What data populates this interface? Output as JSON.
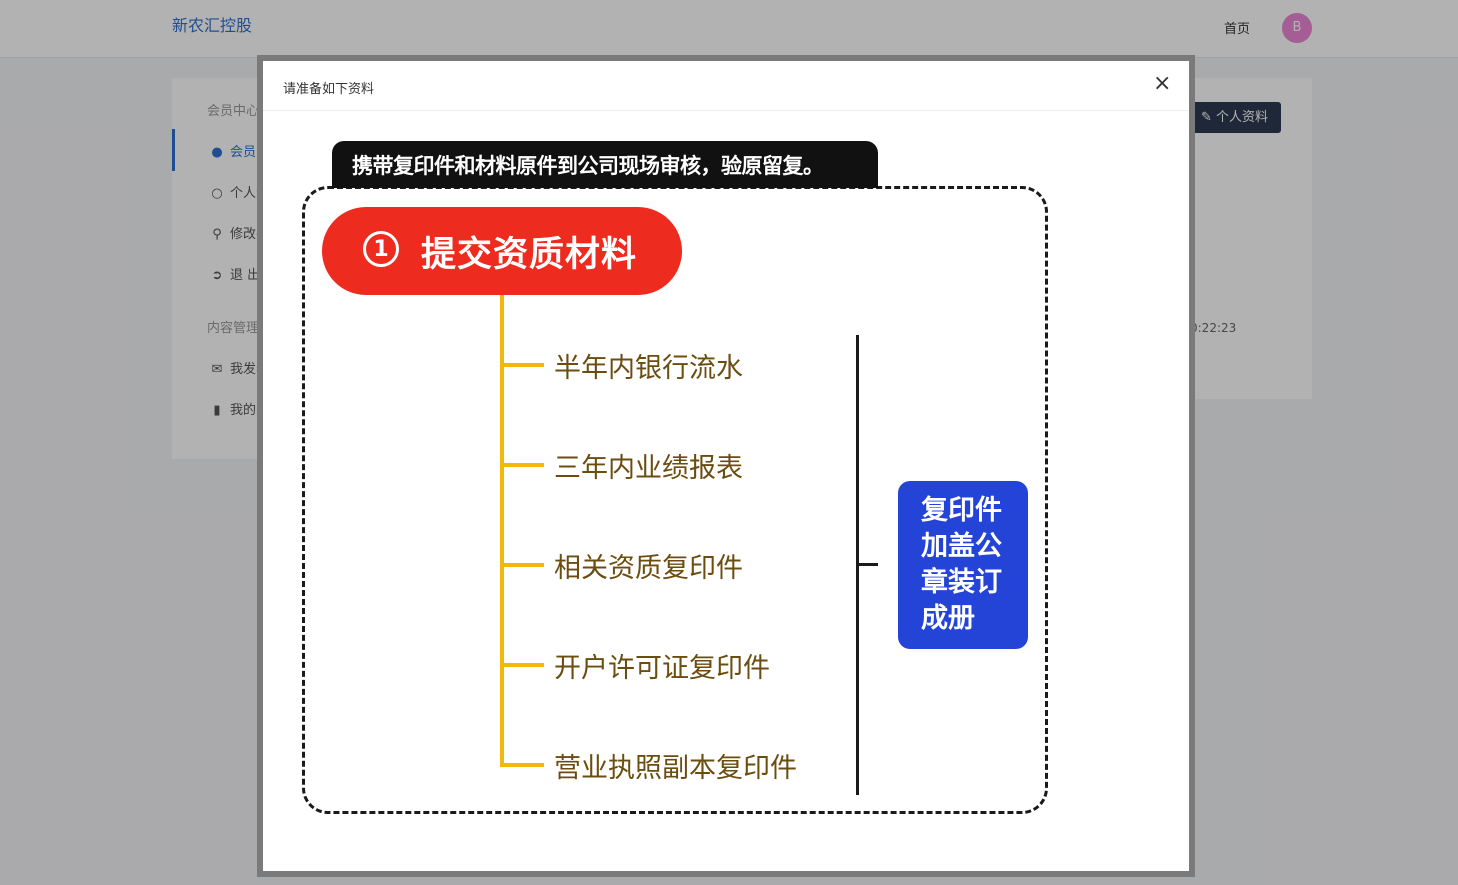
{
  "header": {
    "brand": "新农汇控股",
    "home_link": "首页",
    "avatar_letter": "B"
  },
  "sidebar": {
    "section_member": "会员中心",
    "items_member": [
      {
        "label": "会员中",
        "icon": "user-circle-icon"
      },
      {
        "label": "个人资",
        "icon": "user-icon"
      },
      {
        "label": "修改密",
        "icon": "key-icon"
      },
      {
        "label": "退 出",
        "icon": "sign-out-icon"
      }
    ],
    "section_content": "内容管理",
    "items_content": [
      {
        "label": "我发表",
        "icon": "comments-icon"
      },
      {
        "label": "我的收",
        "icon": "bookmark-icon"
      }
    ]
  },
  "content": {
    "profile_button": "个人资料",
    "timestamp_fragment": "0:22:23"
  },
  "modal": {
    "title": "请准备如下资料",
    "close_label": "×"
  },
  "infographic": {
    "notice": "携带复印件和材料原件到公司现场审核，验原留复。",
    "step_number": "1",
    "step_title": "提交资质材料",
    "items": [
      "半年内银行流水",
      "三年内业绩报表",
      "相关资质复印件",
      "开户许可证复印件",
      "营业执照副本复印件"
    ],
    "summary_lines": [
      "复印件",
      "加盖公",
      "章装订",
      "成册"
    ],
    "colors": {
      "pill": "#ee2b1f",
      "trunk": "#f0b90b",
      "item_text": "#6b4d10",
      "summary_box": "#2444d8",
      "notice_bg": "#111111"
    }
  }
}
